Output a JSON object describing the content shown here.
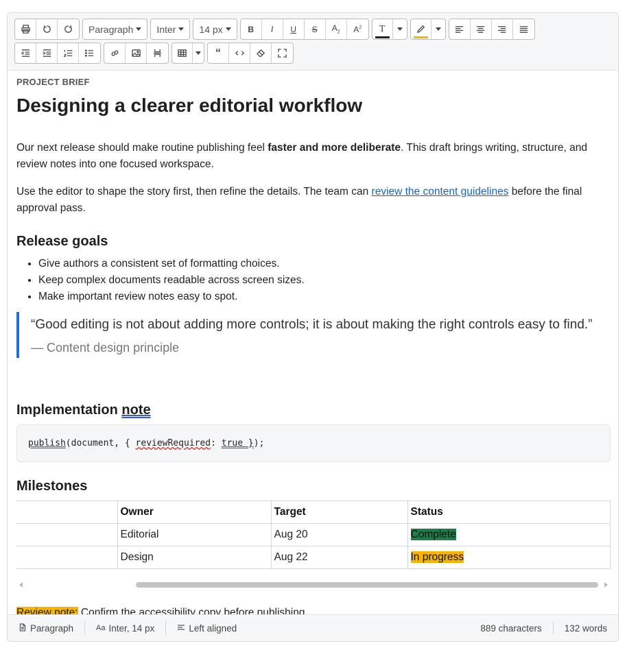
{
  "toolbar": {
    "paragraph_select": "Paragraph",
    "font_select": "Inter",
    "size_select": "14 px",
    "text_color": "#222222",
    "highlight_color": "#f5b400"
  },
  "doc": {
    "kicker": "PROJECT BRIEF",
    "title": "Designing a clearer editorial workflow",
    "p1_before": "Our next release should make routine publishing feel ",
    "p1_bold": "faster and more deliberate",
    "p1_after": ". This draft brings writing, structure, and review notes into one focused workspace.",
    "p2_before": "Use the editor to shape the story first, then refine the details. The team can ",
    "p2_link": "review the content guidelines",
    "p2_after": " before the final approval pass.",
    "goals_heading": "Release goals",
    "goals": [
      "Give authors a consistent set of formatting choices.",
      "Keep complex documents readable across screen sizes.",
      "Make important review notes easy to spot."
    ],
    "quote": "“Good editing is not about adding more controls; it is about making the right controls easy to find.”",
    "quote_cite": "— Content design principle",
    "impl_heading_a": "Implementation ",
    "impl_heading_b": "note",
    "code": {
      "fn": "publish",
      "mid1": "(document, { ",
      "key": "reviewRequired",
      "mid2": ": ",
      "val": "true }",
      "end": ");"
    },
    "milestones_heading": "Milestones",
    "table": {
      "headers": [
        "",
        "Owner",
        "Target",
        "Status"
      ],
      "rows": [
        {
          "c0": "",
          "owner": "Editorial",
          "target": "Aug 20",
          "status": "Complete"
        },
        {
          "c0": "",
          "owner": "Design",
          "target": "Aug 22",
          "status": "In progress"
        }
      ]
    },
    "review_label": "Review note:",
    "review_text": " Confirm the accessibility copy before publishing."
  },
  "status": {
    "block": "Paragraph",
    "font": "Inter, 14 px",
    "align": "Left aligned",
    "chars": "889 characters",
    "words": "132 words"
  }
}
